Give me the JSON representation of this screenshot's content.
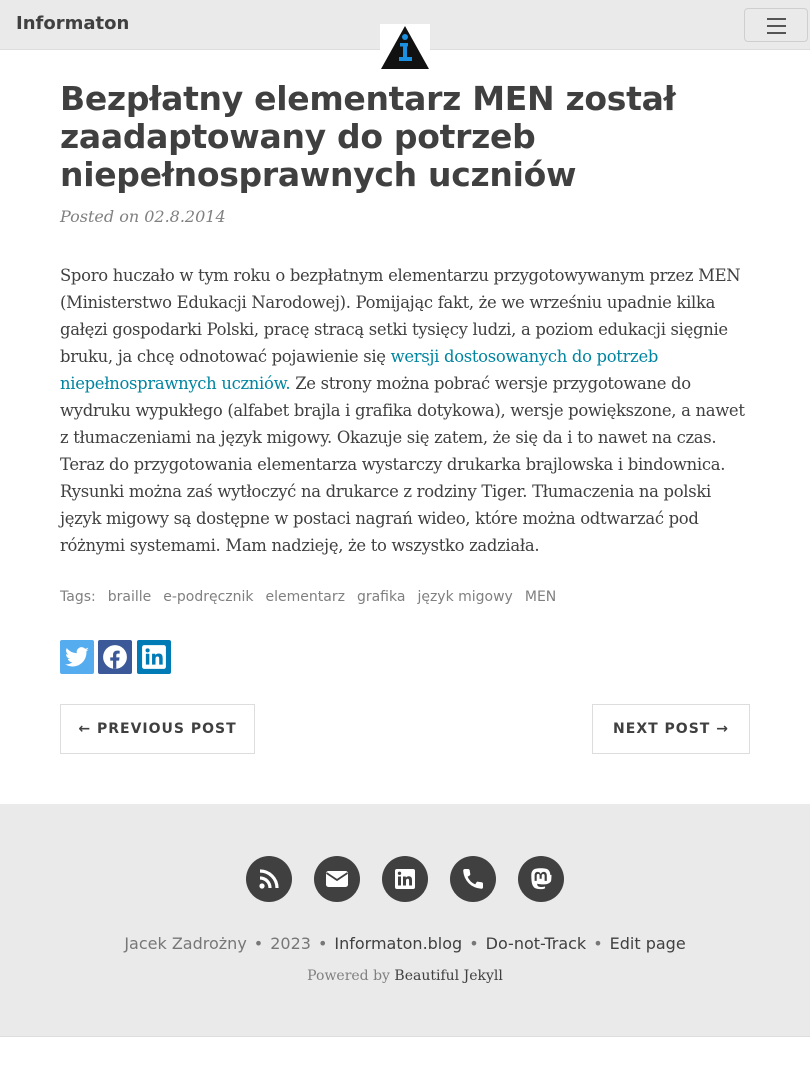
{
  "navbar": {
    "brand": "Informaton",
    "logo_icon": "informaton-triangle-logo-icon",
    "toggle_icon": "hamburger-menu-icon"
  },
  "post": {
    "title": "Bezpłatny elementarz MEN został zaadaptowany do potrzeb niepełnosprawnych uczniów",
    "meta_prefix": "Posted on",
    "date": "02.8.2014",
    "body_part1": "Sporo huczało w tym roku o bezpłatnym elementarzu przygotowywanym przez MEN (Ministerstwo Edukacji Narodowej). Pomijając fakt, że we wrześniu upadnie kilka gałęzi gospodarki Polski, pracę stracą setki tysięcy ludzi, a poziom edukacji sięgnie bruku, ja chcę odnotować pojawienie się",
    "body_link": "wersji dostosowanych do potrzeb niepełnosprawnych uczniów.",
    "body_part2": "Ze strony można pobrać wersje przygotowane do wydruku wypukłego (alfabet brajla i grafika dotykowa), wersje powiększone, a nawet z tłumaczeniami na język migowy. Okazuje się zatem, że się da i to nawet na czas. Teraz do przygotowania elementarza wystarczy drukarka brajlowska i bindownica. Rysunki można zaś wytłoczyć na drukarce z rodziny Tiger. Tłumaczenia na polski język migowy są dostępne w postaci nagrań wideo, które można odtwarzać pod różnymi systemami. Mam nadzieję, że to wszystko zadziała."
  },
  "tags": {
    "label": "Tags:",
    "items": [
      "braille",
      "e-podręcznik",
      "elementarz",
      "grafika",
      "język migowy",
      "MEN"
    ]
  },
  "share": {
    "buttons": [
      {
        "icon": "twitter-icon",
        "color": "#55acee"
      },
      {
        "icon": "facebook-icon",
        "color": "#3b5998"
      },
      {
        "icon": "linkedin-icon",
        "color": "#007bb6"
      }
    ]
  },
  "pager": {
    "previous": "← PREVIOUS POST",
    "next": "NEXT POST →"
  },
  "footer": {
    "social_icons": [
      "rss-icon",
      "email-icon",
      "linkedin-icon",
      "phone-icon",
      "mastodon-icon"
    ],
    "author": "Jacek Zadrożny",
    "year": "2023",
    "site": "Informaton.blog",
    "dnt": "Do-not-Track",
    "edit": "Edit page",
    "powered_prefix": "Powered by",
    "powered_link": "Beautiful Jekyll",
    "separator": "•"
  },
  "colors": {
    "navbar_bg": "#eaeaea",
    "text": "#404040",
    "link": "#0085a1",
    "muted": "#808080"
  }
}
